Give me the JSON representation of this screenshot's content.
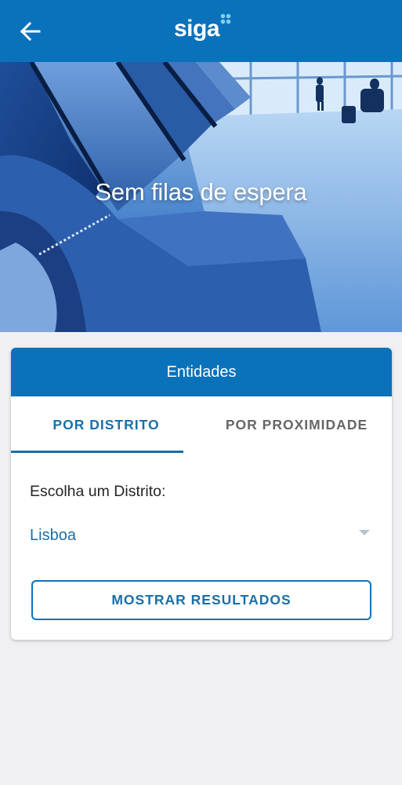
{
  "app_bar": {
    "back_icon": "arrow-left-icon",
    "logo_text": "siga",
    "logo_dots_color": "#7fd0e8",
    "color": "#0a72bb"
  },
  "hero": {
    "caption": "Sem filas de espera"
  },
  "card": {
    "header": "Entidades",
    "tabs": [
      {
        "label": "POR DISTRITO",
        "active": true
      },
      {
        "label": "POR PROXIMIDADE",
        "active": false
      }
    ],
    "field_label": "Escolha um Distrito:",
    "selected_district": "Lisboa",
    "dropdown_icon": "caret-down-icon",
    "button_label": "MOSTRAR RESULTADOS"
  }
}
